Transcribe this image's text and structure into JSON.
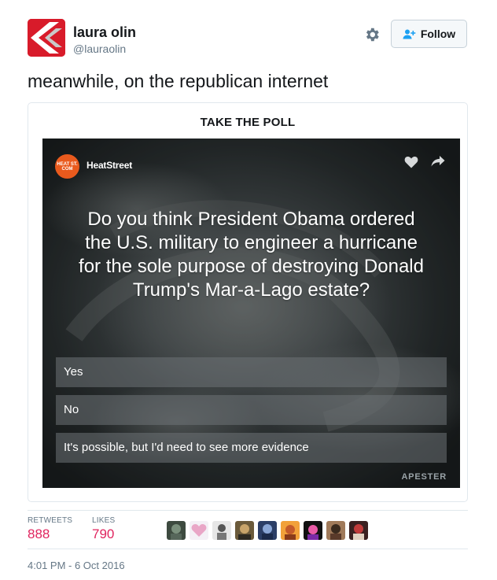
{
  "tweet": {
    "user_name": "laura olin",
    "handle": "@lauraolin",
    "follow_label": "Follow",
    "text": "meanwhile, on the republican internet",
    "timestamp": "4:01 PM - 6 Oct 2016"
  },
  "card": {
    "title": "TAKE THE POLL",
    "publisher_logo_text": "HEAT ST. COM",
    "publisher": "HeatStreet",
    "question": "Do you think President Obama ordered the U.S. military to engineer a hurricane for the sole purpose of destroying Donald Trump's Mar-a-Lago estate?",
    "options": [
      {
        "label": "Yes"
      },
      {
        "label": "No"
      },
      {
        "label": "It's possible, but I'd need to see more evidence"
      }
    ],
    "brand": "APESTER"
  },
  "stats": {
    "retweets_label": "RETWEETS",
    "retweets_value": "888",
    "likes_label": "LIKES",
    "likes_value": "790"
  },
  "colors": {
    "avatar_red": "#d81b2a",
    "like_count": "#e0245e",
    "heat_orange": "#e95a1d",
    "muted_text": "#657786"
  },
  "icons": {
    "settings": "gear-icon",
    "follow": "add-user-icon",
    "poll_like": "heart-icon",
    "poll_share": "share-icon"
  }
}
